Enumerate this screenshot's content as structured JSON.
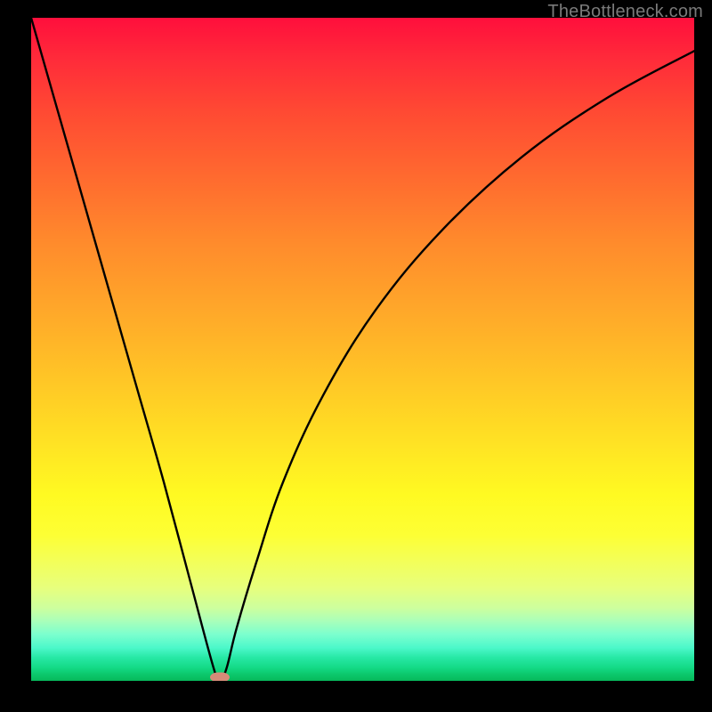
{
  "watermark": "TheBottleneck.com",
  "chart_data": {
    "type": "line",
    "title": "",
    "xlabel": "",
    "ylabel": "",
    "xlim": [
      0,
      100
    ],
    "ylim": [
      0,
      100
    ],
    "grid": false,
    "series": [
      {
        "name": "curve",
        "x": [
          0,
          4,
          8,
          12,
          16,
          20,
          24,
          27.5,
          28.5,
          29.5,
          31,
          34,
          38,
          44,
          52,
          62,
          74,
          87,
          100
        ],
        "values": [
          100,
          86,
          72,
          58,
          44,
          30,
          15,
          2,
          0,
          2,
          8,
          18,
          30,
          43,
          56,
          68,
          79,
          88,
          95
        ]
      }
    ],
    "marker": {
      "x": 28.5,
      "y": 0.6
    },
    "gradient_colors": {
      "top": "#ff0f3c",
      "mid": "#fffa22",
      "bottom": "#07b85b"
    },
    "curve_color": "#000000",
    "marker_color": "#d58b78"
  }
}
